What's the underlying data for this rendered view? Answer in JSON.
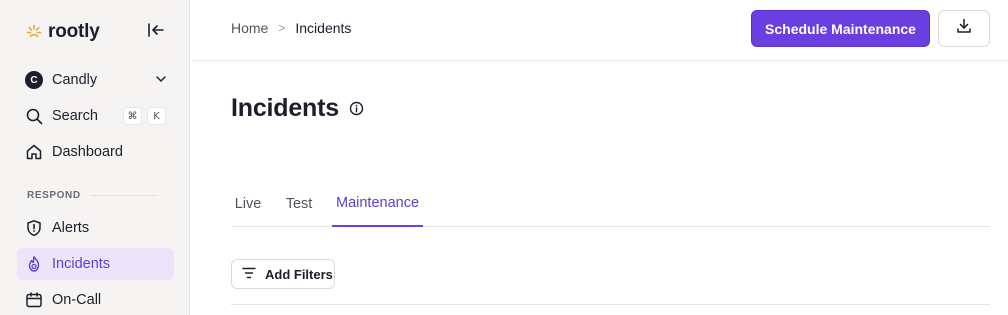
{
  "brand": {
    "name": "rootly",
    "accent": "#f0a33a"
  },
  "sidebar": {
    "org": {
      "avatar_letter": "C",
      "name": "Candly"
    },
    "search": {
      "label": "Search",
      "shortcut_keys": [
        "⌘",
        "K"
      ]
    },
    "dashboard": {
      "label": "Dashboard"
    },
    "section_label": "RESPOND",
    "alerts": {
      "label": "Alerts"
    },
    "incidents": {
      "label": "Incidents",
      "active": true
    },
    "oncall": {
      "label": "On-Call"
    }
  },
  "breadcrumb": {
    "home": "Home",
    "separator": ">",
    "current": "Incidents"
  },
  "header": {
    "primary_button": "Schedule Maintenance",
    "primary_color": "#6a3fe0"
  },
  "page": {
    "title": "Incidents"
  },
  "tabs": [
    {
      "label": "Live",
      "active": false
    },
    {
      "label": "Test",
      "active": false
    },
    {
      "label": "Maintenance",
      "active": true
    }
  ],
  "filters": {
    "add_label": "Add Filters"
  }
}
